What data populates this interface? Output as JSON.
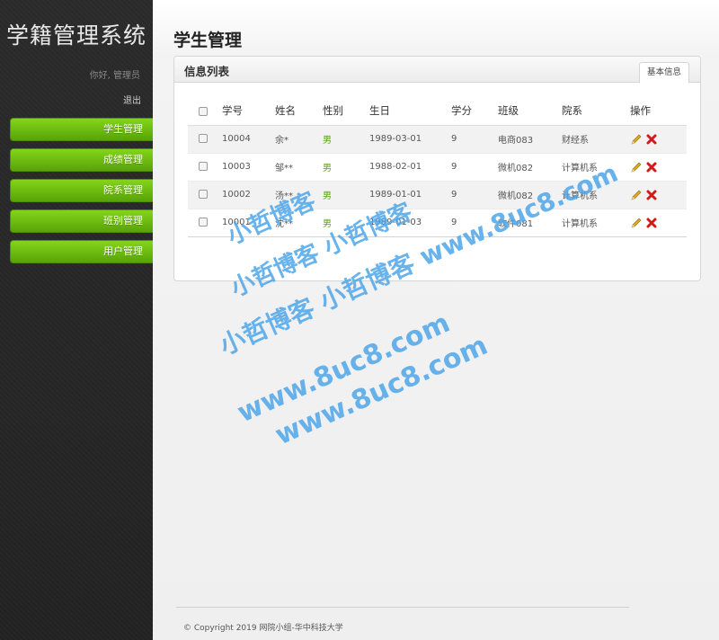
{
  "app": {
    "title": "学籍管理系统"
  },
  "user": {
    "greeting": "你好, 管理员",
    "logout_label": "退出"
  },
  "nav": {
    "items": [
      {
        "label": "学生管理"
      },
      {
        "label": "成绩管理"
      },
      {
        "label": "院系管理"
      },
      {
        "label": "班别管理"
      },
      {
        "label": "用户管理"
      }
    ]
  },
  "page": {
    "title": "学生管理"
  },
  "panel": {
    "title": "信息列表",
    "tab_label": "基本信息"
  },
  "table": {
    "headers": {
      "id": "学号",
      "name": "姓名",
      "gender": "性别",
      "birthday": "生日",
      "credits": "学分",
      "class": "班级",
      "department": "院系",
      "actions": "操作"
    },
    "rows": [
      {
        "id": "10004",
        "name": "余*",
        "gender": "男",
        "birthday": "1989-03-01",
        "credits": "9",
        "class": "电商083",
        "department": "财经系"
      },
      {
        "id": "10003",
        "name": "邹**",
        "gender": "男",
        "birthday": "1988-02-01",
        "credits": "9",
        "class": "微机082",
        "department": "计算机系"
      },
      {
        "id": "10002",
        "name": "汤**",
        "gender": "男",
        "birthday": "1989-01-01",
        "credits": "9",
        "class": "微机082",
        "department": "计算机系"
      },
      {
        "id": "10001",
        "name": "沈**",
        "gender": "男",
        "birthday": "1989-01-03",
        "credits": "9",
        "class": "软件081",
        "department": "计算机系"
      }
    ]
  },
  "footer": {
    "copyright": "© Copyright 2019 网院小组-华中科技大学"
  },
  "watermark": {
    "cn": "小哲博客",
    "cn_repeat": "小哲博客 小哲博客",
    "cn_url": "小哲博客 小哲博客 www.8uc8.com",
    "url": "www.8uc8.com"
  },
  "icons": {
    "edit": "pencil-icon",
    "delete": "delete-x-icon"
  },
  "colors": {
    "nav_green": "#6bbf12",
    "gender_green": "#58a307",
    "watermark_blue": "#4fa6ea",
    "delete_red": "#d11a1a"
  }
}
